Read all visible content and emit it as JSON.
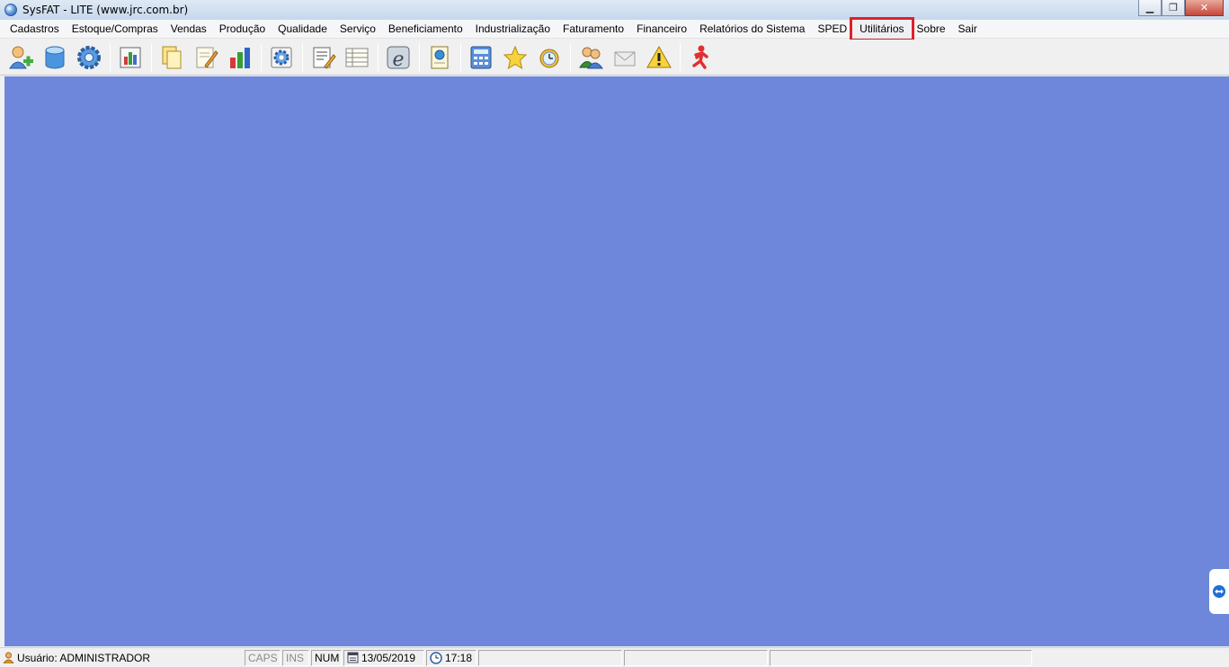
{
  "window": {
    "title": "SysFAT - LITE (www.jrc.com.br)",
    "controls": [
      "minimize",
      "restore",
      "close"
    ]
  },
  "menu": {
    "items": [
      {
        "label": "Cadastros"
      },
      {
        "label": "Estoque/Compras"
      },
      {
        "label": "Vendas"
      },
      {
        "label": "Produção"
      },
      {
        "label": "Qualidade"
      },
      {
        "label": "Serviço"
      },
      {
        "label": "Beneficiamento"
      },
      {
        "label": "Industrialização"
      },
      {
        "label": "Faturamento"
      },
      {
        "label": "Financeiro"
      },
      {
        "label": "Relatórios do Sistema"
      },
      {
        "label": "SPED"
      },
      {
        "label": "Utilitários",
        "highlighted": true
      },
      {
        "label": "Sobre"
      },
      {
        "label": "Sair"
      }
    ]
  },
  "toolbar": {
    "icons": [
      "add-user-icon",
      "database-icon",
      "gear-icon",
      "report-icon",
      "copy-documents-icon",
      "edit-document-icon",
      "bar-chart-icon",
      "settings-document-icon",
      "notepad-icon",
      "list-sheet-icon",
      "nfe-icon",
      "document-globe-icon",
      "calculator-icon",
      "star-icon",
      "alarm-clock-icon",
      "users-icon",
      "mail-icon",
      "warning-icon",
      "exit-runner-icon"
    ]
  },
  "workspace": {
    "background": "#6f87da"
  },
  "status": {
    "user_label": "Usuário: ADMINISTRADOR",
    "caps": "CAPS",
    "ins": "INS",
    "num": "NUM",
    "date": "13/05/2019",
    "time": "17:18"
  }
}
